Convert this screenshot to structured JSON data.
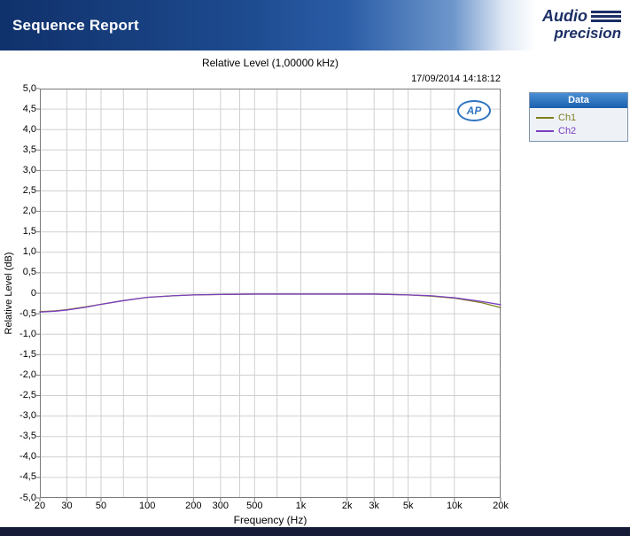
{
  "header": {
    "title": "Sequence Report",
    "logo_line1": "Audio",
    "logo_line2": "precision"
  },
  "chart_data": {
    "type": "line",
    "title": "Relative Level (1,00000 kHz)",
    "timestamp": "17/09/2014 14:18:12",
    "xlabel": "Frequency (Hz)",
    "ylabel": "Relative Level (dB)",
    "x_scale": "log",
    "xlim": [
      20,
      20000
    ],
    "ylim": [
      -5,
      5
    ],
    "y_tick_step": 0.5,
    "grid": true,
    "watermark": "AP",
    "y_tick_labels": [
      "5,0",
      "4,5",
      "4,0",
      "3,5",
      "3,0",
      "2,5",
      "2,0",
      "1,5",
      "1,0",
      "0,5",
      "0",
      "-0,5",
      "-1,0",
      "-1,5",
      "-2,0",
      "-2,5",
      "-3,0",
      "-3,5",
      "-4,0",
      "-4,5",
      "-5,0"
    ],
    "x_ticks": [
      20,
      30,
      50,
      100,
      200,
      300,
      500,
      1000,
      2000,
      3000,
      5000,
      10000,
      20000
    ],
    "x_tick_labels": [
      "20",
      "30",
      "50",
      "100",
      "200",
      "300",
      "500",
      "1k",
      "2k",
      "3k",
      "5k",
      "10k",
      "20k"
    ],
    "x_minor_gridlines": [
      40,
      70,
      400,
      700,
      4000,
      7000
    ],
    "x": [
      20,
      25,
      30,
      40,
      50,
      70,
      100,
      150,
      200,
      300,
      500,
      700,
      1000,
      1500,
      2000,
      3000,
      5000,
      7000,
      10000,
      15000,
      20000
    ],
    "series": [
      {
        "name": "Ch1",
        "color": "#7f7f20",
        "values": [
          -0.45,
          -0.43,
          -0.4,
          -0.33,
          -0.27,
          -0.18,
          -0.1,
          -0.06,
          -0.04,
          -0.03,
          -0.02,
          -0.02,
          -0.02,
          -0.02,
          -0.02,
          -0.02,
          -0.04,
          -0.07,
          -0.12,
          -0.23,
          -0.35
        ]
      },
      {
        "name": "Ch2",
        "color": "#7b3fc0",
        "values": [
          -0.46,
          -0.44,
          -0.41,
          -0.34,
          -0.27,
          -0.18,
          -0.1,
          -0.06,
          -0.04,
          -0.03,
          -0.02,
          -0.02,
          -0.02,
          -0.02,
          -0.02,
          -0.02,
          -0.04,
          -0.06,
          -0.11,
          -0.2,
          -0.28
        ]
      }
    ],
    "legend": {
      "title": "Data",
      "position": "right"
    }
  },
  "colors": {
    "banner_blue": "#10316b",
    "footer_navy": "#161c38",
    "legend_header_blue": "#1a5fae",
    "grid": "#d0d0d0",
    "frame": "#7a7a7a",
    "ap_logo_blue": "#2f74c0",
    "logo_navy": "#1c2f66"
  }
}
